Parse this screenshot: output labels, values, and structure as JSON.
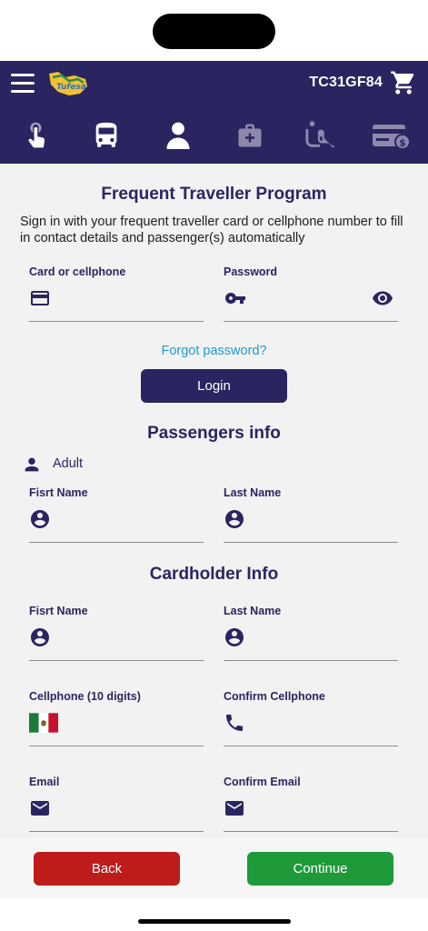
{
  "header": {
    "booking_code": "TC31GF84",
    "brand_text": "Tufesa",
    "colors": {
      "primary": "#2a2560",
      "link": "#1e9ad6",
      "back": "#be1b1b",
      "continue": "#1e9a3a"
    }
  },
  "steps": [
    {
      "icon": "touch-select-icon",
      "state": "complete"
    },
    {
      "icon": "bus-icon",
      "state": "complete"
    },
    {
      "icon": "person-icon",
      "state": "active"
    },
    {
      "icon": "first-aid-kit-icon",
      "state": "pending"
    },
    {
      "icon": "seat-icon",
      "state": "pending"
    },
    {
      "icon": "payment-card-icon",
      "state": "pending"
    }
  ],
  "frequent": {
    "title": "Frequent Traveller Program",
    "intro": "Sign in with your frequent traveller card or cellphone number to fill in contact details and passenger(s) automatically",
    "card_label": "Card or cellphone",
    "card_value": "",
    "password_label": "Password",
    "password_value": "",
    "forgot": "Forgot password?",
    "login": "Login"
  },
  "passengers": {
    "title": "Passengers info",
    "type": "Adult",
    "first_name_label": "Fisrt Name",
    "first_name_value": "",
    "last_name_label": "Last Name",
    "last_name_value": ""
  },
  "cardholder": {
    "title": "Cardholder Info",
    "first_name_label": "Fisrt Name",
    "first_name_value": "",
    "last_name_label": "Last Name",
    "last_name_value": "",
    "cellphone_label": "Cellphone (10 digits)",
    "cellphone_value": "",
    "confirm_cellphone_label": "Confirm Cellphone",
    "confirm_cellphone_value": "",
    "email_label": "Email",
    "email_value": "",
    "confirm_email_label": "Confirm Email",
    "confirm_email_value": ""
  },
  "footer": {
    "back": "Back",
    "continue": "Continue"
  }
}
